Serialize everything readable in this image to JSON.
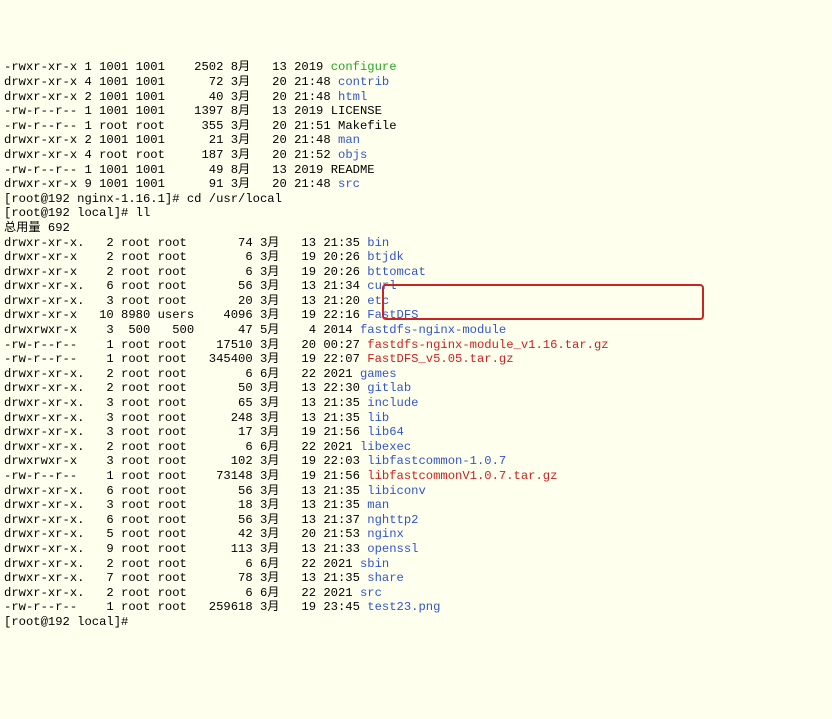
{
  "rows": [
    {
      "perm": "-rwxr-xr-x 1 1001 1001    2502 8月   13 2019 ",
      "name": "configure",
      "cls": "name-green"
    },
    {
      "perm": "drwxr-xr-x 4 1001 1001      72 3月   20 21:48 ",
      "name": "contrib",
      "cls": "name-blue"
    },
    {
      "perm": "drwxr-xr-x 2 1001 1001      40 3月   20 21:48 ",
      "name": "html",
      "cls": "name-blue"
    },
    {
      "perm": "-rw-r--r-- 1 1001 1001    1397 8月   13 2019 ",
      "name": "LICENSE",
      "cls": "name-black"
    },
    {
      "perm": "-rw-r--r-- 1 root root     355 3月   20 21:51 ",
      "name": "Makefile",
      "cls": "name-black"
    },
    {
      "perm": "drwxr-xr-x 2 1001 1001      21 3月   20 21:48 ",
      "name": "man",
      "cls": "name-blue"
    },
    {
      "perm": "drwxr-xr-x 4 root root     187 3月   20 21:52 ",
      "name": "objs",
      "cls": "name-blue"
    },
    {
      "perm": "-rw-r--r-- 1 1001 1001      49 8月   13 2019 ",
      "name": "README",
      "cls": "name-black"
    },
    {
      "perm": "drwxr-xr-x 9 1001 1001      91 3月   20 21:48 ",
      "name": "src",
      "cls": "name-blue"
    }
  ],
  "cmd1": "[root@192 nginx-1.16.1]# cd /usr/local",
  "cmd2": "[root@192 local]# ll",
  "total": "总用量 692",
  "rows2": [
    {
      "perm": "drwxr-xr-x.   2 root root       74 3月   13 21:35 ",
      "name": "bin",
      "cls": "name-blue"
    },
    {
      "perm": "drwxr-xr-x    2 root root        6 3月   19 20:26 ",
      "name": "btjdk",
      "cls": "name-blue"
    },
    {
      "perm": "drwxr-xr-x    2 root root        6 3月   19 20:26 ",
      "name": "bttomcat",
      "cls": "name-blue"
    },
    {
      "perm": "drwxr-xr-x.   6 root root       56 3月   13 21:34 ",
      "name": "curl",
      "cls": "name-blue"
    },
    {
      "perm": "drwxr-xr-x.   3 root root       20 3月   13 21:20 ",
      "name": "etc",
      "cls": "name-blue"
    },
    {
      "perm": "drwxr-xr-x   10 8980 users    4096 3月   19 22:16 ",
      "name": "FastDFS",
      "cls": "name-blue"
    },
    {
      "perm": "drwxrwxr-x    3  500   500      47 5月    4 2014 ",
      "name": "fastdfs-nginx-module",
      "cls": "name-blue"
    },
    {
      "perm": "-rw-r--r--    1 root root    17510 3月   20 00:27 ",
      "name": "fastdfs-nginx-module_v1.16.tar.gz",
      "cls": "name-red"
    },
    {
      "perm": "-rw-r--r--    1 root root   345400 3月   19 22:07 ",
      "name": "FastDFS_v5.05.tar.gz",
      "cls": "name-red"
    },
    {
      "perm": "drwxr-xr-x.   2 root root        6 6月   22 2021 ",
      "name": "games",
      "cls": "name-blue"
    },
    {
      "perm": "drwxr-xr-x.   2 root root       50 3月   13 22:30 ",
      "name": "gitlab",
      "cls": "name-blue"
    },
    {
      "perm": "drwxr-xr-x.   3 root root       65 3月   13 21:35 ",
      "name": "include",
      "cls": "name-blue"
    },
    {
      "perm": "drwxr-xr-x.   3 root root      248 3月   13 21:35 ",
      "name": "lib",
      "cls": "name-blue"
    },
    {
      "perm": "drwxr-xr-x.   3 root root       17 3月   19 21:56 ",
      "name": "lib64",
      "cls": "name-blue"
    },
    {
      "perm": "drwxr-xr-x.   2 root root        6 6月   22 2021 ",
      "name": "libexec",
      "cls": "name-blue"
    },
    {
      "perm": "drwxrwxr-x    3 root root      102 3月   19 22:03 ",
      "name": "libfastcommon-1.0.7",
      "cls": "name-blue"
    },
    {
      "perm": "-rw-r--r--    1 root root    73148 3月   19 21:56 ",
      "name": "libfastcommonV1.0.7.tar.gz",
      "cls": "name-red"
    },
    {
      "perm": "drwxr-xr-x.   6 root root       56 3月   13 21:35 ",
      "name": "libiconv",
      "cls": "name-blue"
    },
    {
      "perm": "drwxr-xr-x.   3 root root       18 3月   13 21:35 ",
      "name": "man",
      "cls": "name-blue"
    },
    {
      "perm": "drwxr-xr-x.   6 root root       56 3月   13 21:37 ",
      "name": "nghttp2",
      "cls": "name-blue"
    },
    {
      "perm": "drwxr-xr-x.   5 root root       42 3月   20 21:53 ",
      "name": "nginx",
      "cls": "name-blue"
    },
    {
      "perm": "drwxr-xr-x.   9 root root      113 3月   13 21:33 ",
      "name": "openssl",
      "cls": "name-blue"
    },
    {
      "perm": "drwxr-xr-x.   2 root root        6 6月   22 2021 ",
      "name": "sbin",
      "cls": "name-blue"
    },
    {
      "perm": "drwxr-xr-x.   7 root root       78 3月   13 21:35 ",
      "name": "share",
      "cls": "name-blue"
    },
    {
      "perm": "drwxr-xr-x.   2 root root        6 6月   22 2021 ",
      "name": "src",
      "cls": "name-blue"
    },
    {
      "perm": "-rw-r--r--    1 root root   259618 3月   19 23:45 ",
      "name": "test23.png",
      "cls": "name-blue"
    }
  ],
  "cmd3": "[root@192 local]# "
}
